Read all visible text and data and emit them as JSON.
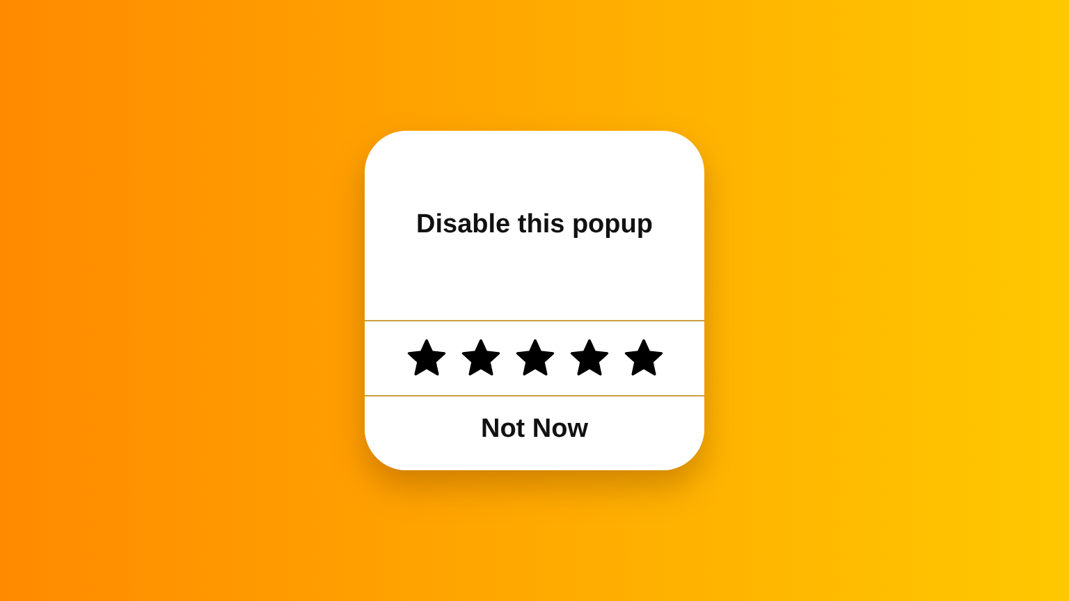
{
  "popup": {
    "title": "Disable this popup",
    "rating": {
      "stars": 5
    },
    "dismiss_button": "Not Now"
  }
}
